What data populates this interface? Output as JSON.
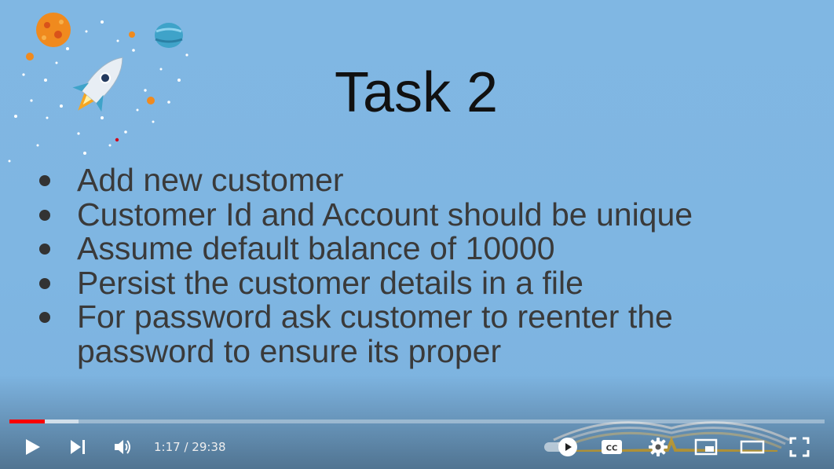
{
  "slide": {
    "title": "Task 2",
    "bullets": [
      "Add new customer",
      "Customer Id and Account should be unique",
      "Assume default balance of 10000",
      "Persist the customer details in a file",
      "For password ask customer to reenter the",
      "password to ensure its proper"
    ]
  },
  "player": {
    "current_time": "1:17",
    "separator": " / ",
    "duration": "29:38",
    "played_fraction": 0.043,
    "buffered_fraction": 0.085,
    "colors": {
      "progress_played": "#ff0000",
      "icon": "#ffffff"
    },
    "icons": {
      "play": "play-icon",
      "next": "next-icon",
      "volume": "volume-icon",
      "autoplay": "autoplay-toggle",
      "captions": "cc-icon",
      "settings": "gear-icon",
      "miniplayer": "miniplayer-icon",
      "theater": "theater-icon",
      "fullscreen": "fullscreen-icon"
    }
  }
}
